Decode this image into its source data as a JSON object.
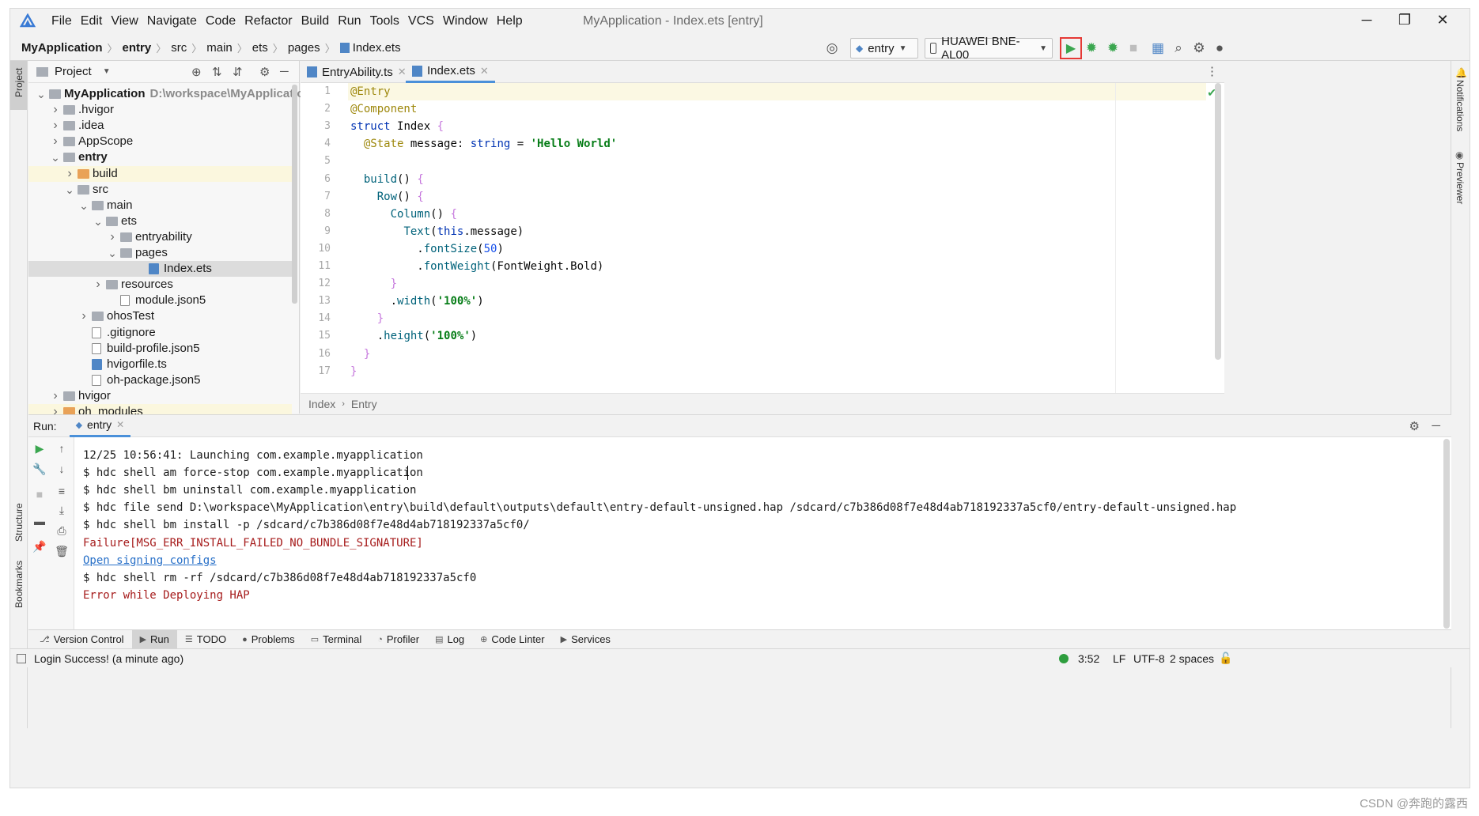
{
  "window": {
    "title": "MyApplication - Index.ets [entry]",
    "menu": [
      "File",
      "Edit",
      "View",
      "Navigate",
      "Code",
      "Refactor",
      "Build",
      "Run",
      "Tools",
      "VCS",
      "Window",
      "Help"
    ],
    "controls": {
      "minimize": "─",
      "restore": "❐",
      "close": "✕"
    }
  },
  "navbar": {
    "breadcrumb": [
      "MyApplication",
      "entry",
      "src",
      "main",
      "ets",
      "pages",
      "Index.ets"
    ],
    "run_config": "entry",
    "device": "HUAWEI BNE-AL00",
    "run_button_highlight": "#e53935"
  },
  "tool_windows": {
    "left_top": "Project",
    "left_bottom": [
      "Structure",
      "Bookmarks"
    ],
    "right": [
      "Notifications",
      "Previewer"
    ]
  },
  "project": {
    "header": "Project",
    "tree": [
      {
        "label": "MyApplication",
        "path": "D:\\workspace\\MyApplication",
        "depth": 0,
        "arrow": "open",
        "icon": "folder",
        "bold": true
      },
      {
        "label": ".hvigor",
        "depth": 1,
        "arrow": "closed",
        "icon": "folder"
      },
      {
        "label": ".idea",
        "depth": 1,
        "arrow": "closed",
        "icon": "folder"
      },
      {
        "label": "AppScope",
        "depth": 1,
        "arrow": "closed",
        "icon": "folder"
      },
      {
        "label": "entry",
        "depth": 1,
        "arrow": "open",
        "icon": "folder",
        "bold": true
      },
      {
        "label": "build",
        "depth": 2,
        "arrow": "closed",
        "icon": "ofolder",
        "highlight": true
      },
      {
        "label": "src",
        "depth": 2,
        "arrow": "open",
        "icon": "folder"
      },
      {
        "label": "main",
        "depth": 3,
        "arrow": "open",
        "icon": "folder"
      },
      {
        "label": "ets",
        "depth": 4,
        "arrow": "open",
        "icon": "folder"
      },
      {
        "label": "entryability",
        "depth": 5,
        "arrow": "closed",
        "icon": "folder"
      },
      {
        "label": "pages",
        "depth": 5,
        "arrow": "open",
        "icon": "folder"
      },
      {
        "label": "Index.ets",
        "depth": 7,
        "arrow": "",
        "icon": "ts",
        "selected": true
      },
      {
        "label": "resources",
        "depth": 4,
        "arrow": "closed",
        "icon": "folder"
      },
      {
        "label": "module.json5",
        "depth": 5,
        "arrow": "",
        "icon": "file"
      },
      {
        "label": "ohosTest",
        "depth": 3,
        "arrow": "closed",
        "icon": "folder"
      },
      {
        "label": ".gitignore",
        "depth": 3,
        "arrow": "",
        "icon": "file"
      },
      {
        "label": "build-profile.json5",
        "depth": 3,
        "arrow": "",
        "icon": "file"
      },
      {
        "label": "hvigorfile.ts",
        "depth": 3,
        "arrow": "",
        "icon": "ts"
      },
      {
        "label": "oh-package.json5",
        "depth": 3,
        "arrow": "",
        "icon": "file"
      },
      {
        "label": "hvigor",
        "depth": 1,
        "arrow": "closed",
        "icon": "folder"
      },
      {
        "label": "oh_modules",
        "depth": 1,
        "arrow": "closed",
        "icon": "ofolder",
        "highlight": true
      }
    ]
  },
  "editor": {
    "tabs": [
      {
        "label": "EntryAbility.ts",
        "active": false
      },
      {
        "label": "Index.ets",
        "active": true
      }
    ],
    "lines": [
      [
        [
          "an",
          "@Entry"
        ]
      ],
      [
        [
          "an",
          "@Component"
        ]
      ],
      [
        [
          "kw",
          "struct "
        ],
        [
          "pl",
          "Index "
        ],
        [
          "br",
          "{"
        ]
      ],
      [
        [
          "pl",
          "  "
        ],
        [
          "an",
          "@State "
        ],
        [
          "pl",
          "message"
        ],
        [
          "pl",
          ": "
        ],
        [
          "kw",
          "string"
        ],
        [
          "pl",
          " = "
        ],
        [
          "str",
          "'Hello World'"
        ]
      ],
      [
        [
          "pl",
          ""
        ]
      ],
      [
        [
          "pl",
          "  "
        ],
        [
          "fn",
          "build"
        ],
        [
          "pl",
          "() "
        ],
        [
          "br",
          "{"
        ]
      ],
      [
        [
          "pl",
          "    "
        ],
        [
          "fn",
          "Row"
        ],
        [
          "pl",
          "() "
        ],
        [
          "br",
          "{"
        ]
      ],
      [
        [
          "pl",
          "      "
        ],
        [
          "fn",
          "Column"
        ],
        [
          "pl",
          "() "
        ],
        [
          "br",
          "{"
        ]
      ],
      [
        [
          "pl",
          "        "
        ],
        [
          "fn",
          "Text"
        ],
        [
          "pl",
          "("
        ],
        [
          "kw",
          "this"
        ],
        [
          "pl",
          ".message)"
        ]
      ],
      [
        [
          "pl",
          "          ."
        ],
        [
          "fn",
          "fontSize"
        ],
        [
          "pl",
          "("
        ],
        [
          "num",
          "50"
        ],
        [
          "pl",
          ")"
        ]
      ],
      [
        [
          "pl",
          "          ."
        ],
        [
          "fn",
          "fontWeight"
        ],
        [
          "pl",
          "(FontWeight.Bold)"
        ]
      ],
      [
        [
          "pl",
          "      "
        ],
        [
          "br",
          "}"
        ]
      ],
      [
        [
          "pl",
          "      ."
        ],
        [
          "fn",
          "width"
        ],
        [
          "pl",
          "("
        ],
        [
          "str",
          "'100%'"
        ],
        [
          "pl",
          ")"
        ]
      ],
      [
        [
          "pl",
          "    "
        ],
        [
          "br",
          "}"
        ]
      ],
      [
        [
          "pl",
          "    ."
        ],
        [
          "fn",
          "height"
        ],
        [
          "pl",
          "("
        ],
        [
          "str",
          "'100%'"
        ],
        [
          "pl",
          ")"
        ]
      ],
      [
        [
          "pl",
          "  "
        ],
        [
          "br",
          "}"
        ]
      ],
      [
        [
          "br",
          "}"
        ]
      ]
    ],
    "breadcrumb": [
      "Index",
      "Entry"
    ]
  },
  "run": {
    "label": "Run:",
    "tab": "entry",
    "console": [
      {
        "text": "12/25 10:56:41: Launching com.example.myapplication",
        "kind": "normal"
      },
      {
        "text": "$ hdc shell am force-stop com.example.myapplication",
        "kind": "normal"
      },
      {
        "text": "$ hdc shell bm uninstall com.example.myapplication",
        "kind": "normal"
      },
      {
        "text": "$ hdc file send D:\\workspace\\MyApplication\\entry\\build\\default\\outputs\\default\\entry-default-unsigned.hap /sdcard/c7b386d08f7e48d4ab718192337a5cf0/entry-default-unsigned.hap",
        "kind": "normal"
      },
      {
        "text": "$ hdc shell bm install -p /sdcard/c7b386d08f7e48d4ab718192337a5cf0/",
        "kind": "normal"
      },
      {
        "text": "Failure[MSG_ERR_INSTALL_FAILED_NO_BUNDLE_SIGNATURE]",
        "kind": "err"
      },
      {
        "text": "Open signing configs",
        "kind": "link"
      },
      {
        "text": "$ hdc shell rm -rf /sdcard/c7b386d08f7e48d4ab718192337a5cf0",
        "kind": "normal"
      },
      {
        "text": "Error while Deploying HAP",
        "kind": "err"
      }
    ]
  },
  "bottom_tabs": [
    {
      "label": "Version Control",
      "icon": "⎇",
      "active": false
    },
    {
      "label": "Run",
      "icon": "▶",
      "active": true
    },
    {
      "label": "TODO",
      "icon": "☰",
      "active": false
    },
    {
      "label": "Problems",
      "icon": "●",
      "active": false
    },
    {
      "label": "Terminal",
      "icon": "▭",
      "active": false
    },
    {
      "label": "Profiler",
      "icon": "◔",
      "active": false
    },
    {
      "label": "Log",
      "icon": "▤",
      "active": false
    },
    {
      "label": "Code Linter",
      "icon": "⊕",
      "active": false
    },
    {
      "label": "Services",
      "icon": "▶",
      "active": false
    }
  ],
  "status": {
    "message": "Login Success! (a minute ago)",
    "position": "3:52",
    "line_sep": "LF",
    "encoding": "UTF-8",
    "indent": "2 spaces"
  },
  "watermark": "CSDN @奔跑的露西"
}
